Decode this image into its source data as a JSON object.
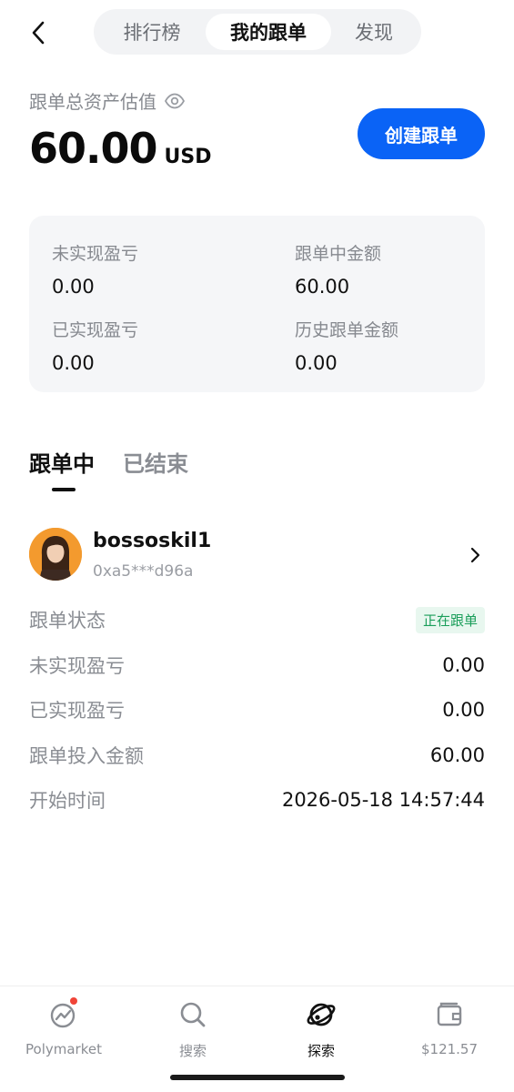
{
  "header": {
    "tabs": [
      {
        "label": "排行榜"
      },
      {
        "label": "我的跟单"
      },
      {
        "label": "发现"
      }
    ]
  },
  "asset": {
    "label": "跟单总资产估值",
    "value": "60.00",
    "currency": "USD",
    "create_label": "创建跟单"
  },
  "stats": {
    "unrealized_label": "未实现盈亏",
    "unrealized_value": "0.00",
    "in_progress_label": "跟单中金额",
    "in_progress_value": "60.00",
    "realized_label": "已实现盈亏",
    "realized_value": "0.00",
    "history_label": "历史跟单金额",
    "history_value": "0.00"
  },
  "subtabs": {
    "active": "跟单中",
    "ended": "已结束"
  },
  "trader": {
    "name": "bossoskil1",
    "address": "0xa5***d96a"
  },
  "details": {
    "status_label": "跟单状态",
    "status_badge": "正在跟单",
    "unrealized_label": "未实现盈亏",
    "unrealized_value": "0.00",
    "realized_label": "已实现盈亏",
    "realized_value": "0.00",
    "invest_label": "跟单投入金额",
    "invest_value": "60.00",
    "start_label": "开始时间",
    "start_value": "2026-05-18 14:57:44"
  },
  "nav": {
    "items": [
      {
        "label": "Polymarket",
        "icon": "chart-icon"
      },
      {
        "label": "搜索",
        "icon": "search-icon"
      },
      {
        "label": "探索",
        "icon": "planet-icon"
      },
      {
        "label": "$121.57",
        "icon": "wallet-icon"
      }
    ]
  },
  "colors": {
    "accent": "#0a63f6",
    "badge_green": "#1a9e5a",
    "notification_red": "#f04438"
  }
}
